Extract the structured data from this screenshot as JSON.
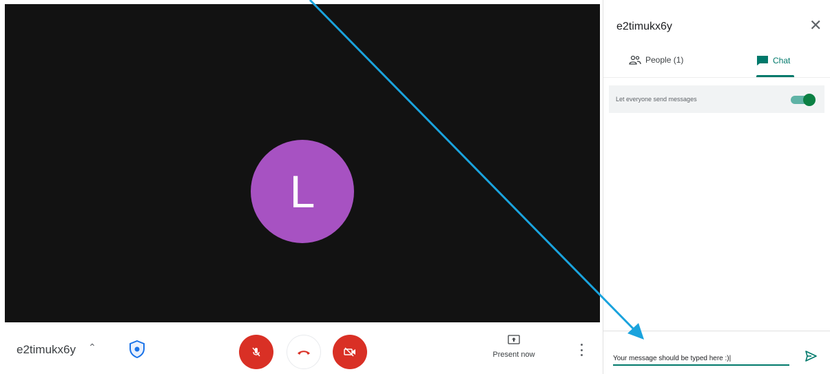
{
  "stage": {
    "avatar_initial": "L"
  },
  "callbar": {
    "meeting_code": "e2timukx6y",
    "present_label": "Present now"
  },
  "panel": {
    "title": "e2timukx6y",
    "tabs": [
      {
        "label": "People (1)",
        "icon": "people-icon"
      },
      {
        "label": "Chat",
        "icon": "chat-icon",
        "active": true
      }
    ],
    "setting_label": "Let everyone send messages",
    "setting_enabled": true,
    "input_value": "Your message should be typed here :)|"
  },
  "colors": {
    "stage_bg": "#121212",
    "avatar": "#a752c2",
    "danger": "#d93025",
    "accent": "#00796b",
    "arrow": "#1aa3dd"
  }
}
